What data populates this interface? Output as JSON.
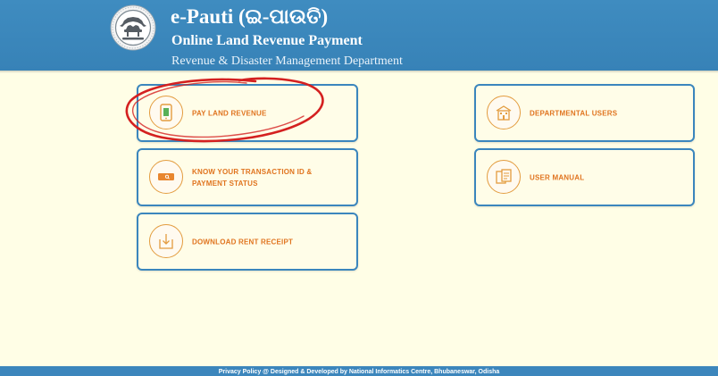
{
  "header": {
    "title": "e-Pauti (ଇ-ପାଉତି)",
    "subtitle": "Online Land Revenue Payment",
    "department": "Revenue & Disaster Management Department",
    "emblem_icon": "odisha-emblem-icon"
  },
  "cards": {
    "pay_land_revenue": {
      "label": "PAY LAND REVENUE",
      "icon": "mobile-payment-icon"
    },
    "transaction_status": {
      "label": "KNOW YOUR TRANSACTION ID & PAYMENT STATUS",
      "icon": "search-card-icon"
    },
    "download_receipt": {
      "label": "DOWNLOAD RENT RECEIPT",
      "icon": "download-icon"
    },
    "departmental_users": {
      "label": "DEPARTMENTAL USERS",
      "icon": "building-icon"
    },
    "user_manual": {
      "label": "USER MANUAL",
      "icon": "manual-book-icon"
    }
  },
  "footer": {
    "text": "Privacy Policy   @ Designed & Developed by National Informatics Centre, Bhubaneswar, Odisha"
  },
  "colors": {
    "header_blue": "#3c86bc",
    "page_background": "#fffee6",
    "card_border": "#3b86bd",
    "label_orange": "#e0741f",
    "icon_orange": "#e39c3f",
    "annotation_red": "#d42020"
  }
}
